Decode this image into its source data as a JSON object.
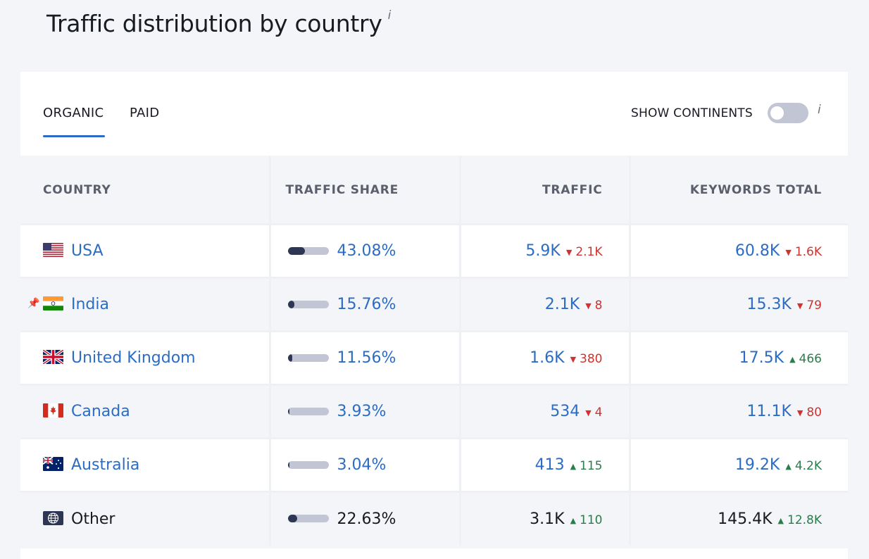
{
  "title": "Traffic distribution by country",
  "title_info": "i",
  "tabs": {
    "organic": "ORGANIC",
    "paid": "PAID"
  },
  "show_continents": {
    "label": "SHOW CONTINENTS",
    "info": "i",
    "enabled": false
  },
  "columns": {
    "country": "COUNTRY",
    "traffic_share": "TRAFFIC SHARE",
    "traffic": "TRAFFIC",
    "keywords_total": "KEYWORDS TOTAL"
  },
  "rows": [
    {
      "country": "USA",
      "flag": "us-flag-icon",
      "share": "43.08%",
      "share_fraction": 0.43,
      "traffic": "5.9K",
      "traffic_delta": "2.1K",
      "traffic_dir": "down",
      "keywords": "60.8K",
      "keywords_delta": "1.6K",
      "keywords_dir": "down"
    },
    {
      "country": "India",
      "flag": "india-flag-icon",
      "pinned": true,
      "share": "15.76%",
      "share_fraction": 0.158,
      "traffic": "2.1K",
      "traffic_delta": "8",
      "traffic_dir": "down",
      "keywords": "15.3K",
      "keywords_delta": "79",
      "keywords_dir": "down"
    },
    {
      "country": "United Kingdom",
      "flag": "uk-flag-icon",
      "share": "11.56%",
      "share_fraction": 0.116,
      "traffic": "1.6K",
      "traffic_delta": "380",
      "traffic_dir": "down",
      "keywords": "17.5K",
      "keywords_delta": "466",
      "keywords_dir": "up"
    },
    {
      "country": "Canada",
      "flag": "canada-flag-icon",
      "share": "3.93%",
      "share_fraction": 0.039,
      "traffic": "534",
      "traffic_delta": "4",
      "traffic_dir": "down",
      "keywords": "11.1K",
      "keywords_delta": "80",
      "keywords_dir": "down"
    },
    {
      "country": "Australia",
      "flag": "australia-flag-icon",
      "share": "3.04%",
      "share_fraction": 0.03,
      "traffic": "413",
      "traffic_delta": "115",
      "traffic_dir": "up",
      "keywords": "19.2K",
      "keywords_delta": "4.2K",
      "keywords_dir": "up"
    },
    {
      "country": "Other",
      "flag": "globe-icon",
      "share": "22.63%",
      "share_fraction": 0.226,
      "traffic": "3.1K",
      "traffic_delta": "110",
      "traffic_dir": "up",
      "keywords": "145.4K",
      "keywords_delta": "12.8K",
      "keywords_dir": "up"
    }
  ],
  "colors": {
    "link": "#2b6cc4",
    "down": "#d1322e",
    "up": "#2a7d4b",
    "bar_fill": "#2e3656",
    "bar_track": "#c2c6d4"
  }
}
